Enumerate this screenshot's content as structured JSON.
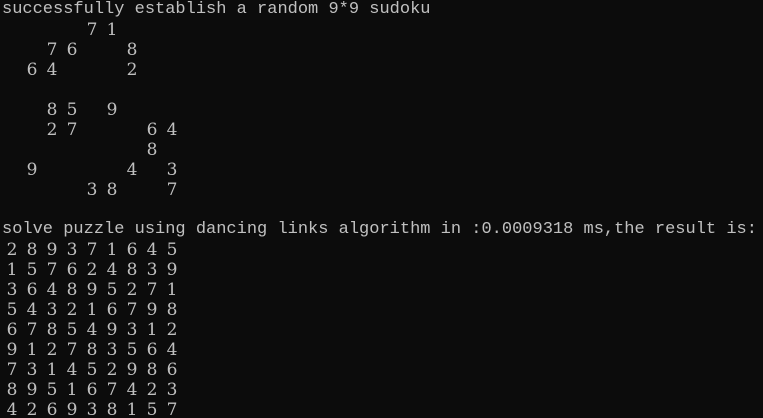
{
  "console": {
    "header": "successfully establish a random 9*9 sudoku",
    "puzzle": [
      [
        "",
        "",
        "",
        "",
        "7",
        "1",
        "",
        "",
        ""
      ],
      [
        "",
        "",
        "7",
        "6",
        "",
        "",
        "8",
        "",
        ""
      ],
      [
        "",
        "6",
        "4",
        "",
        "",
        "",
        "2",
        "",
        ""
      ],
      [
        "",
        "",
        "",
        "",
        "",
        "",
        "",
        "",
        ""
      ],
      [
        "",
        "",
        "8",
        "5",
        "",
        "9",
        "",
        "",
        ""
      ],
      [
        "",
        "",
        "2",
        "7",
        "",
        "",
        "",
        "6",
        "4"
      ],
      [
        "",
        "",
        "",
        "",
        "",
        "",
        "",
        "8",
        ""
      ],
      [
        "",
        "9",
        "",
        "",
        "",
        "",
        "4",
        "",
        "3"
      ],
      [
        "",
        "",
        "",
        "",
        "3",
        "8",
        "",
        "",
        "7"
      ]
    ],
    "blank_line": "",
    "solve_message": "solve puzzle using dancing links algorithm in :0.0009318 ms,the result is:",
    "solution": [
      [
        "2",
        "8",
        "9",
        "3",
        "7",
        "1",
        "6",
        "4",
        "5"
      ],
      [
        "1",
        "5",
        "7",
        "6",
        "2",
        "4",
        "8",
        "3",
        "9"
      ],
      [
        "3",
        "6",
        "4",
        "8",
        "9",
        "5",
        "2",
        "7",
        "1"
      ],
      [
        "5",
        "4",
        "3",
        "2",
        "1",
        "6",
        "7",
        "9",
        "8"
      ],
      [
        "6",
        "7",
        "8",
        "5",
        "4",
        "9",
        "3",
        "1",
        "2"
      ],
      [
        "9",
        "1",
        "2",
        "7",
        "8",
        "3",
        "5",
        "6",
        "4"
      ],
      [
        "7",
        "3",
        "1",
        "4",
        "5",
        "2",
        "9",
        "8",
        "6"
      ],
      [
        "8",
        "9",
        "5",
        "1",
        "6",
        "7",
        "4",
        "2",
        "3"
      ],
      [
        "4",
        "2",
        "6",
        "9",
        "3",
        "8",
        "1",
        "5",
        "7"
      ]
    ]
  }
}
